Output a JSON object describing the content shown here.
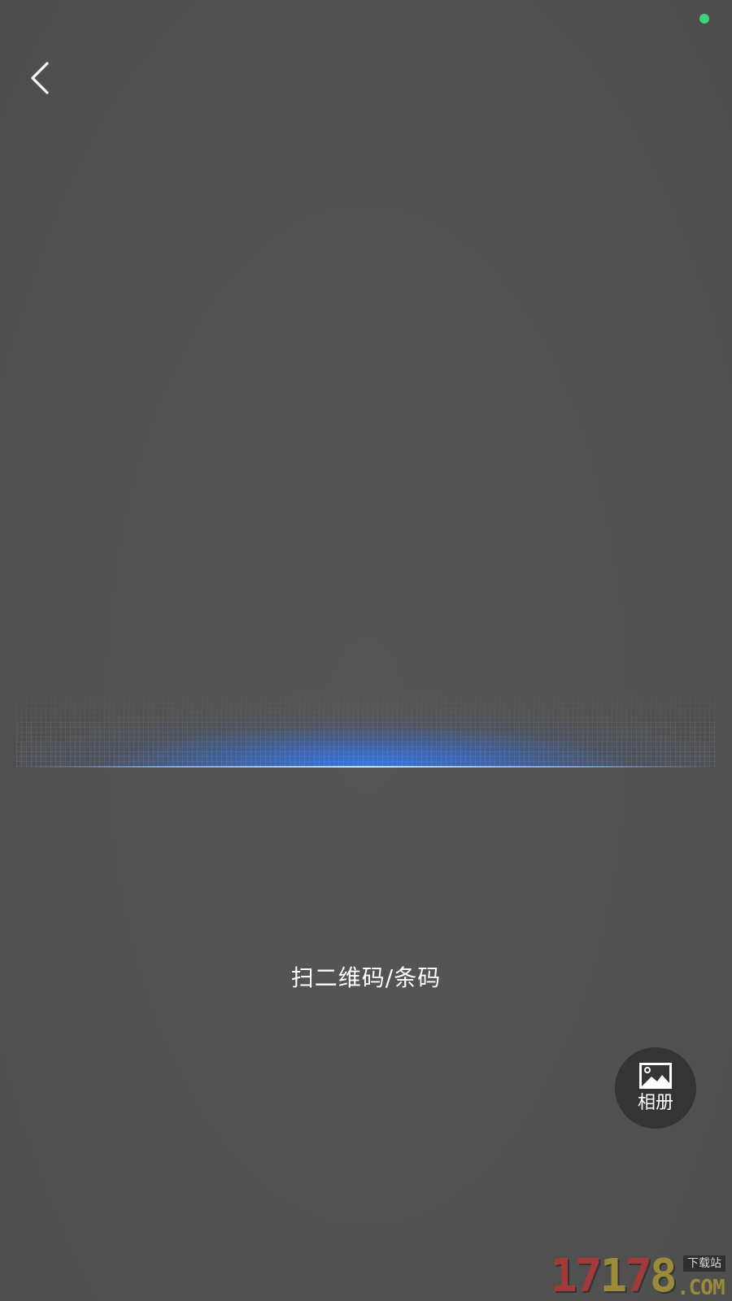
{
  "status_bar": {
    "indicator_icon": "green-dot-indicator",
    "indicator_color": "#3ad47a"
  },
  "header": {
    "back_icon": "chevron-left-icon"
  },
  "scanner": {
    "hint": "扫二维码/条码",
    "accent_color": "#2d7dff"
  },
  "album_button": {
    "icon": "image-icon",
    "label": "相册"
  },
  "watermark": {
    "digits_red_1": "17",
    "digits_gold_1": "1",
    "digits_red_2": "7",
    "digits_gold_2": "8",
    "tag": "下载站",
    "domain": ".COM"
  }
}
